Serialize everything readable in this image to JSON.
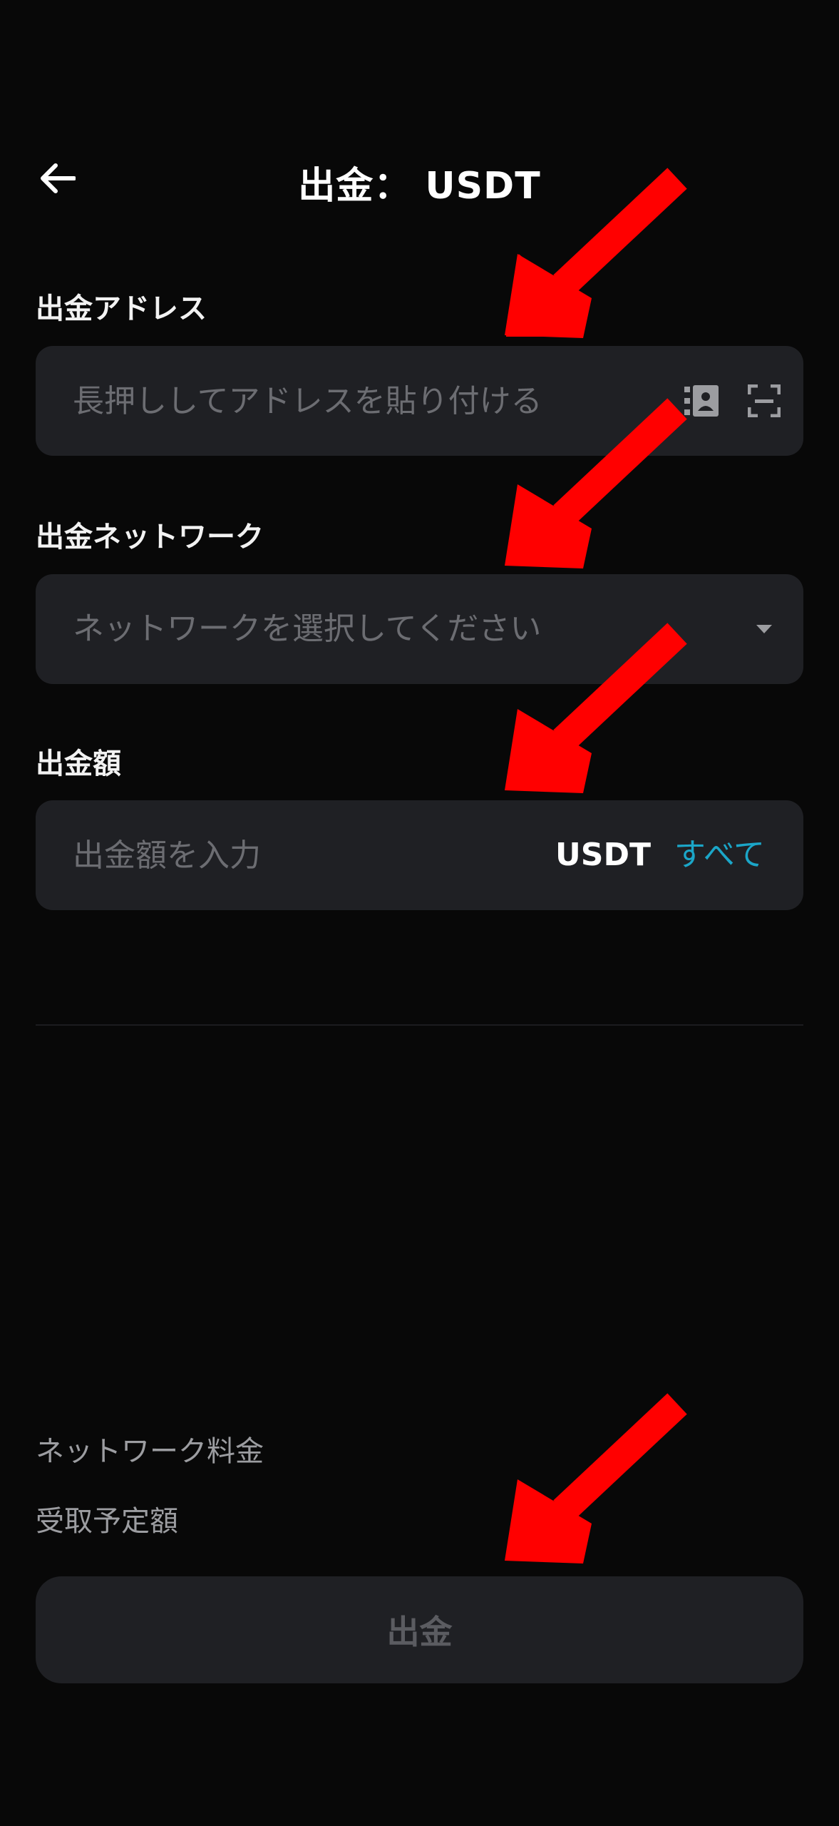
{
  "header": {
    "title": "出金： USDT"
  },
  "address": {
    "label": "出金アドレス",
    "placeholder": "長押ししてアドレスを貼り付ける"
  },
  "network": {
    "label": "出金ネットワーク",
    "placeholder": "ネットワークを選択してください"
  },
  "amount": {
    "label": "出金額",
    "placeholder": "出金額を入力",
    "unit": "USDT",
    "all_label": "すべて"
  },
  "summary": {
    "fee_label": "ネットワーク料金",
    "receive_label": "受取予定額"
  },
  "submit": {
    "label": "出金"
  },
  "colors": {
    "background": "#080808",
    "field": "#1f2024",
    "placeholder": "#6c6d72",
    "accent_link": "#1ba6c8",
    "annotation_arrow": "#ff0000"
  },
  "icons": {
    "back": "arrow-left-icon",
    "address_book": "address-book-icon",
    "scan": "scan-icon",
    "dropdown": "caret-down-icon",
    "annotation": "red-arrow-annotation"
  }
}
